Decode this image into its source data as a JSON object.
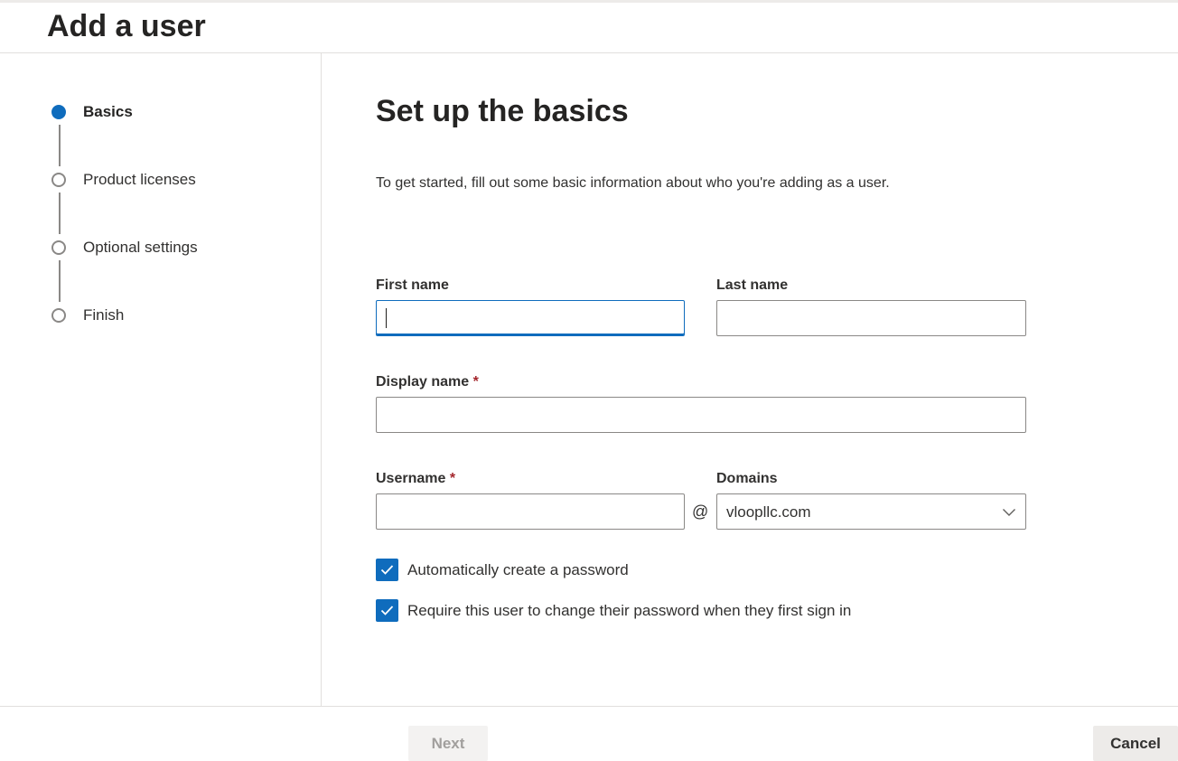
{
  "page": {
    "title": "Add a user"
  },
  "steps": [
    {
      "label": "Basics",
      "state": "active"
    },
    {
      "label": "Product licenses",
      "state": "inactive"
    },
    {
      "label": "Optional settings",
      "state": "inactive"
    },
    {
      "label": "Finish",
      "state": "inactive"
    }
  ],
  "main": {
    "heading": "Set up the basics",
    "intro": "To get started, fill out some basic information about who you're adding as a user."
  },
  "form": {
    "first_name": {
      "label": "First name",
      "value": ""
    },
    "last_name": {
      "label": "Last name",
      "value": ""
    },
    "display_name": {
      "label": "Display name",
      "required_marker": "*",
      "value": ""
    },
    "username": {
      "label": "Username",
      "required_marker": "*",
      "value": ""
    },
    "at_symbol": "@",
    "domains": {
      "label": "Domains",
      "selected": "vloopllc.com"
    },
    "auto_password": {
      "label": "Automatically create a password",
      "checked": true
    },
    "require_change": {
      "label": "Require this user to change their password when they first sign in",
      "checked": true
    }
  },
  "footer": {
    "next_label": "Next",
    "cancel_label": "Cancel"
  },
  "colors": {
    "accent": "#0f6cbd",
    "required": "#a4262c"
  },
  "icons": {
    "checkbox": "checkmark-icon",
    "dropdown": "chevron-down-icon"
  }
}
